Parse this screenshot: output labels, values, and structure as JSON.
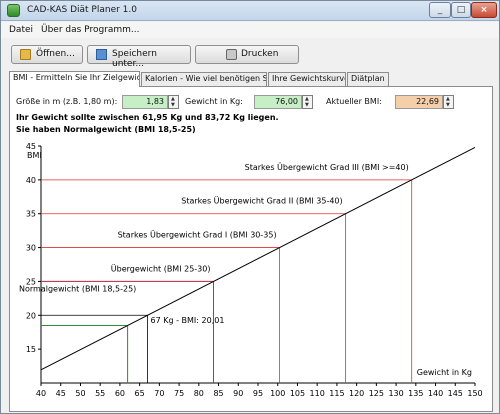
{
  "window": {
    "title": "CAD-KAS Diät Planer 1.0"
  },
  "menu": [
    "Datei",
    "Über das Programm..."
  ],
  "toolbar": {
    "open_label": "Öffnen...",
    "save_label": "Speichern unter...",
    "print_label": "Drucken"
  },
  "tabs": [
    "BMI - Ermitteln Sie Ihr Zielgewicht",
    "Kalorien - Wie viel benötigen Sie?",
    "Ihre Gewichtskurve",
    "Diätplan"
  ],
  "form": {
    "height_label": "Größe in m (z.B. 1,80 m):",
    "height_value": "1,83",
    "weight_label": "Gewicht in Kg:",
    "weight_value": "76,00",
    "bmi_label": "Aktueller BMI:",
    "bmi_value": "22,69"
  },
  "result": {
    "line1": "Ihr Gewicht sollte zwischen 61,95 Kg und 83,72 Kg liegen.",
    "line2": "Sie haben Normalgewicht (BMI 18,5-25)"
  },
  "chart_data": {
    "type": "line",
    "title": "",
    "xlabel": "Gewicht in Kg",
    "ylabel": "BMI",
    "xlim": [
      40,
      150
    ],
    "ylim": [
      10,
      45
    ],
    "x_ticks": [
      40,
      45,
      50,
      55,
      60,
      65,
      70,
      75,
      80,
      85,
      90,
      95,
      100,
      105,
      110,
      115,
      120,
      125,
      130,
      135,
      140,
      145,
      150
    ],
    "y_ticks": [
      15,
      20,
      25,
      30,
      35,
      40,
      45
    ],
    "series": [
      {
        "x": [
          40,
          150
        ],
        "y": [
          11.94,
          44.79
        ]
      }
    ],
    "categories_lines": [
      {
        "label": "Normalgewicht (BMI 18,5-25)",
        "bmi_low": 18.5,
        "bmi_high": 25,
        "weight_low": 61.95,
        "weight_high": 83.72,
        "color": "#1f3fbf"
      },
      {
        "label": "Übergewicht (BMI 25-30)",
        "bmi": 25,
        "weight": 83.72,
        "color": "#e03030"
      },
      {
        "label": "Starkes Übergewicht Grad I (BMI 30-35)",
        "bmi": 30,
        "weight": 100.47,
        "color": "#e03030"
      },
      {
        "label": "Starkes Übergewicht Grad II (BMI 35-40)",
        "bmi": 35,
        "weight": 117.21,
        "color": "#e03030"
      },
      {
        "label": "Starkes Übergewicht Grad III (BMI >=40)",
        "bmi": 40,
        "weight": 133.96,
        "color": "#e03030"
      }
    ],
    "current": {
      "label": "67 Kg - BMI: 20,01",
      "weight": 67,
      "bmi": 20.01
    },
    "grid": false
  }
}
